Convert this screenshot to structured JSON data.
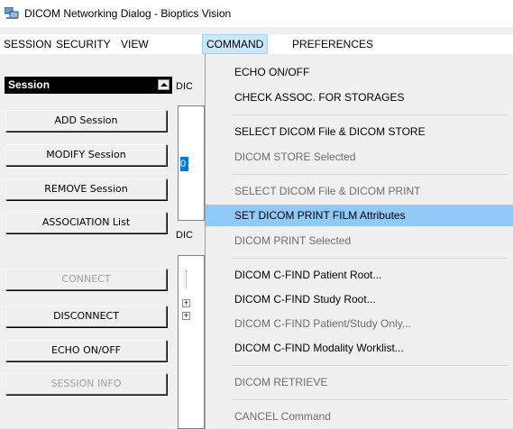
{
  "window": {
    "title": "DICOM Networking Dialog - Bioptics Vision",
    "icon": "network-computers-icon"
  },
  "menubar": [
    {
      "label": "SESSION",
      "active": false
    },
    {
      "label": "SECURITY",
      "active": false
    },
    {
      "label": "VIEW",
      "active": false
    },
    {
      "label": "COMMAND",
      "active": true
    },
    {
      "label": "PREFERENCES",
      "active": false
    }
  ],
  "session_panel": {
    "header": "Session",
    "buttons": [
      {
        "label": "ADD Session",
        "enabled": true
      },
      {
        "label": "MODIFY Session",
        "enabled": true
      },
      {
        "label": "REMOVE Session",
        "enabled": true
      },
      {
        "label": "ASSOCIATION List",
        "enabled": true
      },
      {
        "label": "CONNECT",
        "enabled": false
      },
      {
        "label": "DISCONNECT",
        "enabled": true
      },
      {
        "label": "ECHO ON/OFF",
        "enabled": true
      },
      {
        "label": "SESSION INFO",
        "enabled": false
      }
    ]
  },
  "background_fragments": {
    "dic_label_1": "DIC",
    "dic_label_2": "DIC",
    "selected_fragment": "0"
  },
  "command_menu": [
    {
      "label": "ECHO ON/OFF",
      "enabled": true
    },
    {
      "label": "CHECK ASSOC. FOR STORAGES",
      "enabled": true
    },
    {
      "separator": true
    },
    {
      "label": "SELECT DICOM File & DICOM STORE",
      "enabled": true
    },
    {
      "label": "DICOM STORE Selected",
      "enabled": false
    },
    {
      "separator": true
    },
    {
      "label": "SELECT DICOM File & DICOM PRINT",
      "enabled": false
    },
    {
      "label": "SET DICOM PRINT FILM Attributes",
      "enabled": true,
      "highlighted": true
    },
    {
      "label": "DICOM PRINT Selected",
      "enabled": false
    },
    {
      "separator": true
    },
    {
      "label": "DICOM C-FIND Patient Root...",
      "enabled": true
    },
    {
      "label": "DICOM C-FIND Study Root...",
      "enabled": true
    },
    {
      "label": "DICOM C-FIND Patient/Study Only...",
      "enabled": false
    },
    {
      "label": "DICOM C-FIND Modality Worklist...",
      "enabled": true
    },
    {
      "separator": true
    },
    {
      "label": "DICOM RETRIEVE",
      "enabled": false
    },
    {
      "separator": true
    },
    {
      "label": "CANCEL Command",
      "enabled": false
    }
  ]
}
